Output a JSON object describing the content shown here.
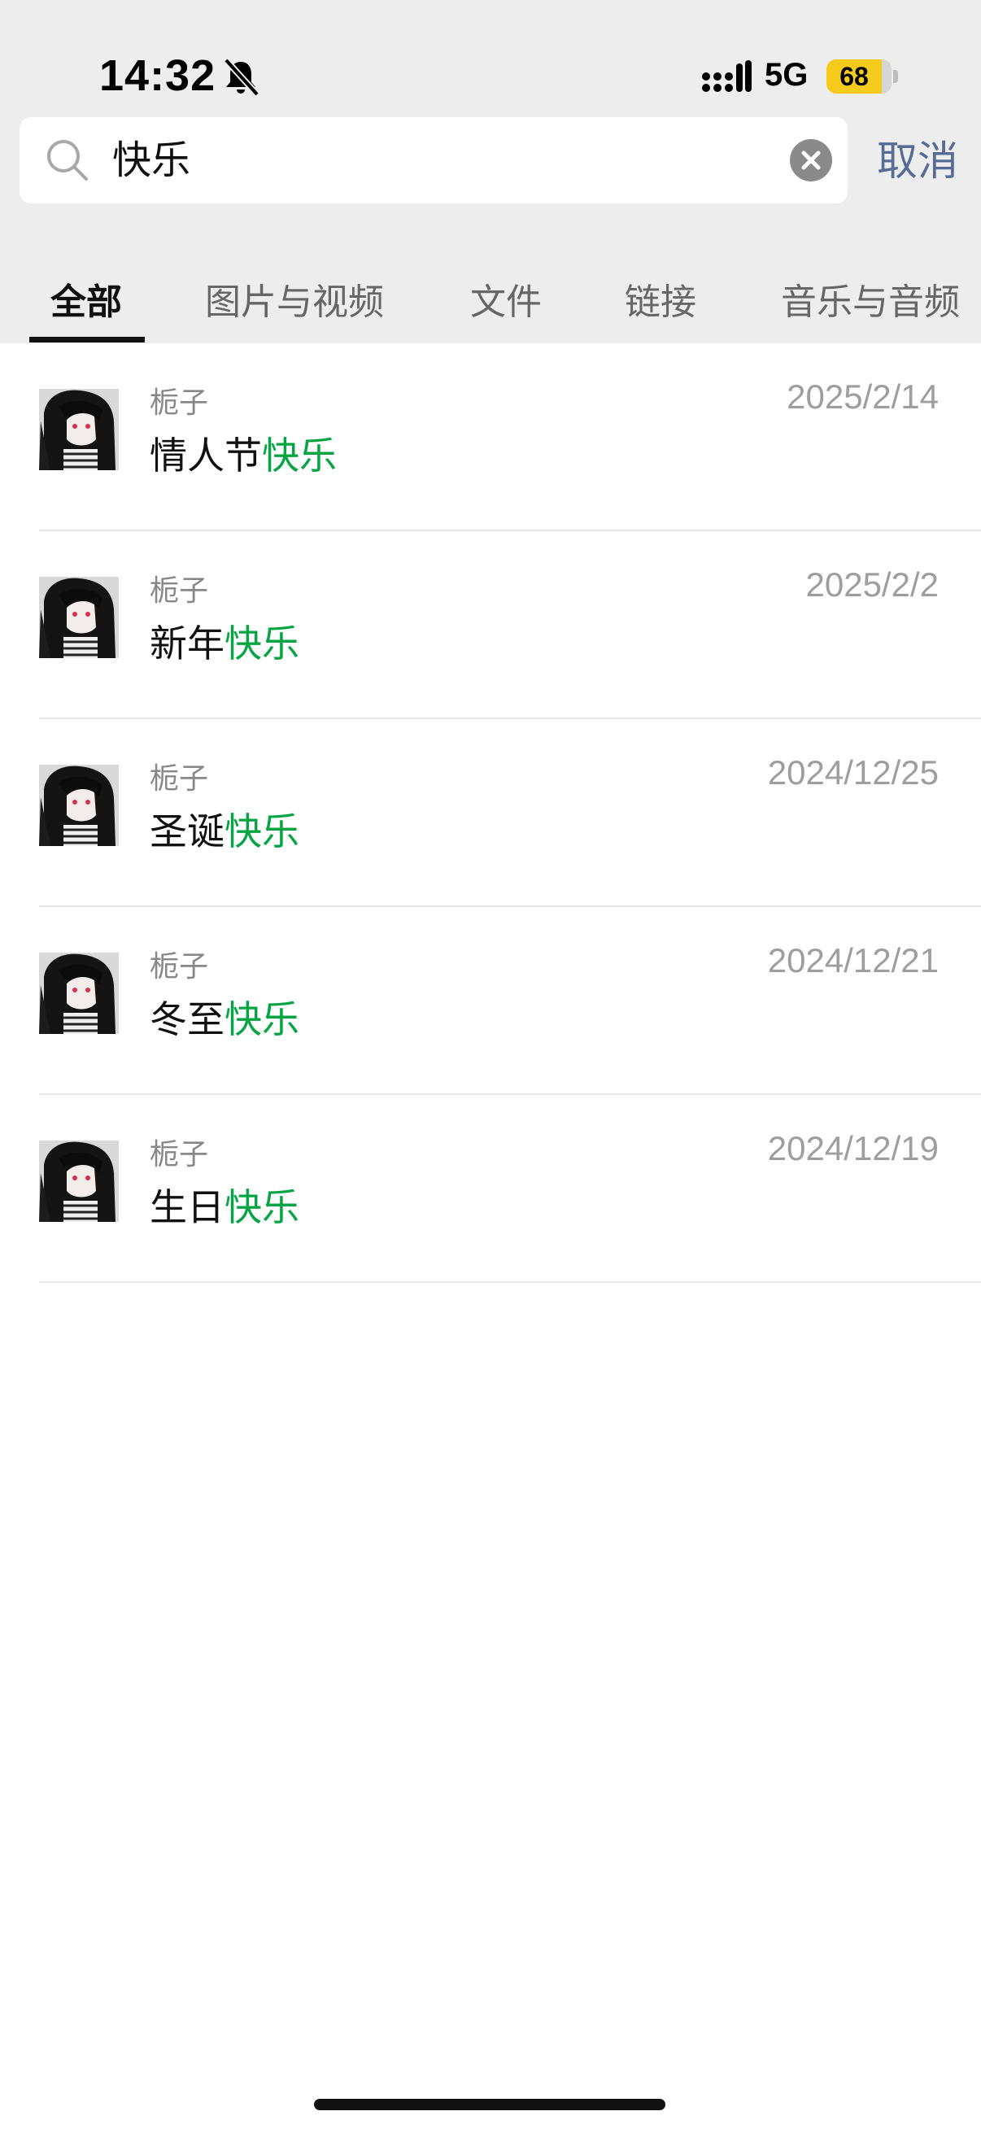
{
  "status_bar": {
    "time": "14:32",
    "network": "5G",
    "battery": "68"
  },
  "search": {
    "query": "快乐",
    "cancel_label": "取消"
  },
  "tabs": [
    {
      "label": "全部"
    },
    {
      "label": "图片与视频"
    },
    {
      "label": "文件"
    },
    {
      "label": "链接"
    },
    {
      "label": "音乐与音频"
    }
  ],
  "results": [
    {
      "sender": "栀子",
      "date": "2025/2/14",
      "prefix": "情人节",
      "match": "快乐"
    },
    {
      "sender": "栀子",
      "date": "2025/2/2",
      "prefix": "新年",
      "match": "快乐"
    },
    {
      "sender": "栀子",
      "date": "2024/12/25",
      "prefix": "圣诞",
      "match": "快乐"
    },
    {
      "sender": "栀子",
      "date": "2024/12/21",
      "prefix": "冬至",
      "match": "快乐"
    },
    {
      "sender": "栀子",
      "date": "2024/12/19",
      "prefix": "生日",
      "match": "快乐"
    }
  ],
  "colors": {
    "highlight": "#07a443",
    "cancel": "#576b95",
    "header_bg": "#ededed",
    "battery": "#f7cb1b"
  },
  "icons": [
    "bell-slash-icon",
    "signal-icon",
    "search-icon",
    "clear-icon"
  ]
}
